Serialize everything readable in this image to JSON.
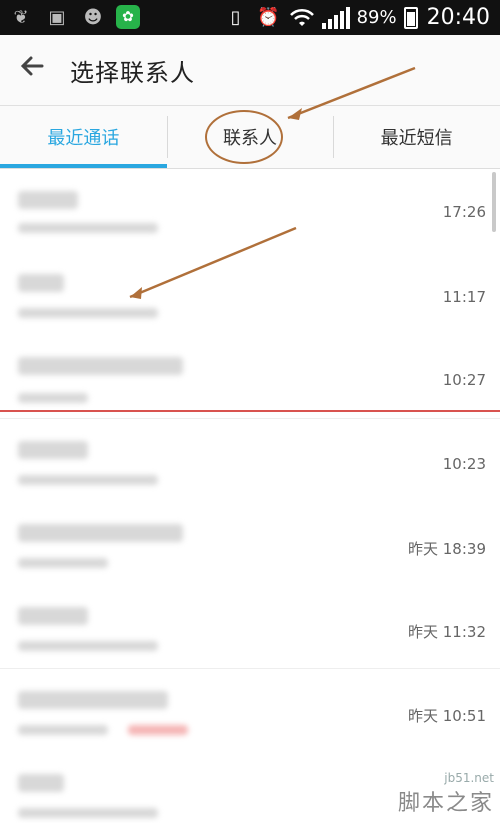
{
  "status": {
    "battery": "89%",
    "time": "20:40",
    "battery_level": 0.89
  },
  "appbar": {
    "title": "选择联系人",
    "back_icon": "arrow-left-icon"
  },
  "tabs": [
    {
      "label": "最近通话",
      "active": true
    },
    {
      "label": "联系人",
      "active": false
    },
    {
      "label": "最近短信",
      "active": false
    }
  ],
  "calls": [
    {
      "time": "17:26"
    },
    {
      "time": "11:17"
    },
    {
      "time": "10:27"
    },
    {
      "time": "10:23"
    },
    {
      "time": "昨天 18:39"
    },
    {
      "time": "昨天 11:32"
    },
    {
      "time": "昨天 10:51"
    },
    {
      "time": ""
    }
  ],
  "watermark": {
    "site": "jb51.net",
    "name": "脚本之家"
  },
  "colors": {
    "accent": "#2aa7e0",
    "annotation": "#b0703a",
    "divider_red": "#d9534f"
  }
}
